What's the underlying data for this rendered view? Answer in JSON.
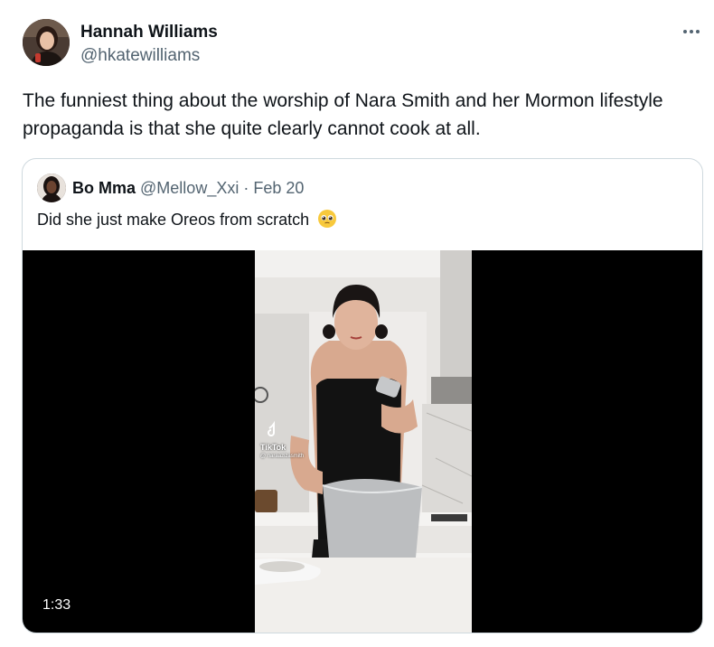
{
  "author": {
    "name": "Hannah Williams",
    "handle": "@hkatewilliams"
  },
  "tweet": {
    "text": "The funniest thing about the worship of Nara Smith and her Mormon lifestyle propaganda is that she quite clearly cannot cook at all."
  },
  "quoted": {
    "name": "Bo Mma",
    "handle": "@Mellow_Xxi",
    "separator": "·",
    "date": "Feb 20",
    "text": "Did she just make Oreos from scratch",
    "emoji": "pleading-face-emoji",
    "video": {
      "duration": "1:33",
      "watermark_label": "TikTok",
      "watermark_handle": "@ naraazizasmith"
    }
  },
  "icons": {
    "more": "more-horizontal-icon",
    "tiktok": "tiktok-logo-icon"
  },
  "colors": {
    "text_primary": "#0f1419",
    "text_secondary": "#536471",
    "border": "#cfd9de",
    "video_background": "#000000"
  }
}
